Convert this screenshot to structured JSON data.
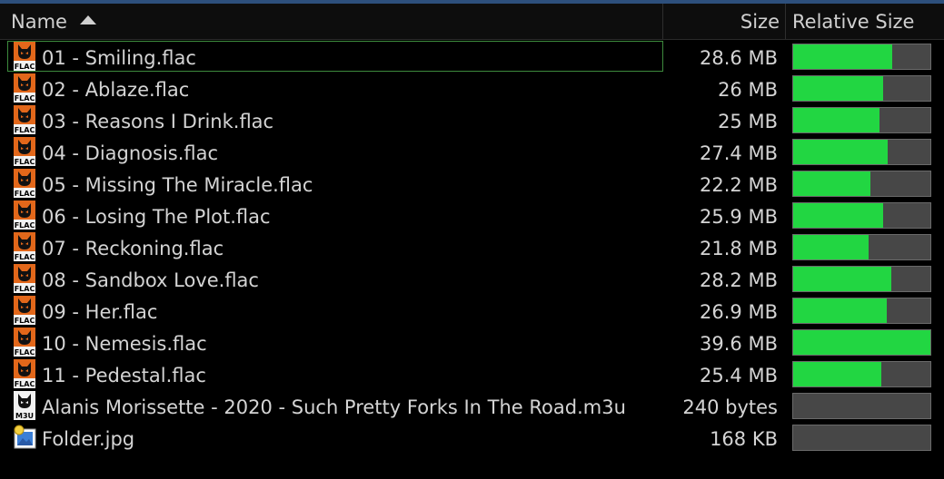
{
  "colors": {
    "background": "#000000",
    "bar_fill": "#22d642",
    "bar_track": "#474747",
    "selection_outline": "#3d8a3d",
    "flac_icon": "#e2671a"
  },
  "header": {
    "name_label": "Name",
    "size_label": "Size",
    "relative_size_label": "Relative Size",
    "sort": "ascending",
    "sort_icon": "sort-ascending-icon"
  },
  "files": [
    {
      "name": "01 - Smiling.flac",
      "size": "28.6 MB",
      "relative": 0.722,
      "icon": "flac-file-icon",
      "selected": true
    },
    {
      "name": "02 - Ablaze.flac",
      "size": "26 MB",
      "relative": 0.657,
      "icon": "flac-file-icon"
    },
    {
      "name": "03 - Reasons I Drink.flac",
      "size": "25 MB",
      "relative": 0.631,
      "icon": "flac-file-icon"
    },
    {
      "name": "04 - Diagnosis.flac",
      "size": "27.4 MB",
      "relative": 0.692,
      "icon": "flac-file-icon"
    },
    {
      "name": "05 - Missing The Miracle.flac",
      "size": "22.2 MB",
      "relative": 0.561,
      "icon": "flac-file-icon"
    },
    {
      "name": "06 - Losing The Plot.flac",
      "size": "25.9 MB",
      "relative": 0.654,
      "icon": "flac-file-icon"
    },
    {
      "name": "07 - Reckoning.flac",
      "size": "21.8 MB",
      "relative": 0.551,
      "icon": "flac-file-icon"
    },
    {
      "name": "08 - Sandbox Love.flac",
      "size": "28.2 MB",
      "relative": 0.712,
      "icon": "flac-file-icon"
    },
    {
      "name": "09 - Her.flac",
      "size": "26.9 MB",
      "relative": 0.679,
      "icon": "flac-file-icon"
    },
    {
      "name": "10 - Nemesis.flac",
      "size": "39.6 MB",
      "relative": 1.0,
      "icon": "flac-file-icon"
    },
    {
      "name": "11 - Pedestal.flac",
      "size": "25.4 MB",
      "relative": 0.641,
      "icon": "flac-file-icon"
    },
    {
      "name": "Alanis Morissette - 2020 - Such Pretty Forks In The Road.m3u",
      "size": "240 bytes",
      "relative": 0.0,
      "icon": "m3u-file-icon"
    },
    {
      "name": "Folder.jpg",
      "size": "168 KB",
      "relative": 0.0,
      "icon": "image-file-icon"
    }
  ]
}
